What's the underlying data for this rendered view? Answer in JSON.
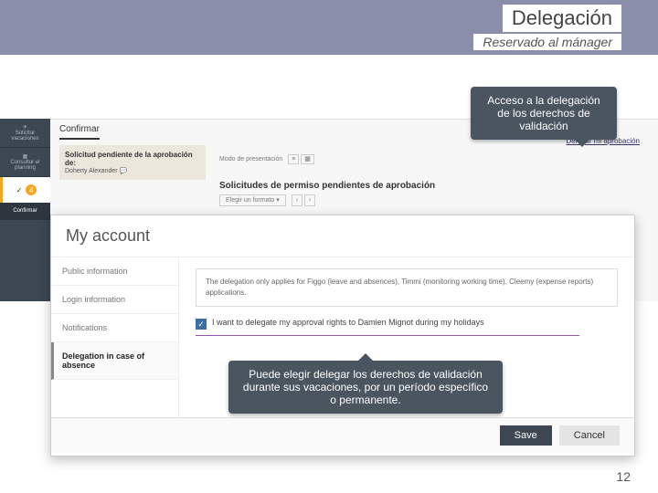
{
  "header": {
    "title": "Delegación",
    "subtitle": "Reservado al mánager"
  },
  "callouts": {
    "access": "Acceso a la delegación de los derechos de validación",
    "choose": "Puede elegir delegar los derechos de validación durante sus vacaciones, por un período específico o permanente."
  },
  "bg": {
    "sidebar": {
      "item1": "Solicitar vacaciones",
      "item2": "Consultar el planning",
      "confirm": "Confirmar",
      "badge": "4"
    },
    "tab": "Confirmar",
    "card_title": "Solicitud pendiente de la aprobación de:",
    "card_name": "Doherty Alexander",
    "mode": "Modo de presentación",
    "heading": "Solicitudes de permiso pendientes de aprobación",
    "filter": "Elegir un formato",
    "link": "Delegar mi aprobación"
  },
  "modal": {
    "title": "My account",
    "nav": {
      "pub": "Public information",
      "login": "Login information",
      "notif": "Notifications",
      "deleg": "Delegation in case of absence"
    },
    "info": "The delegation only applies for Figgo (leave and absences), Timmi (monitoring working time), Cleemy (expense reports) applications.",
    "check_text": "I want to delegate my approval rights to Damien Mignot during my holidays",
    "save": "Save",
    "cancel": "Cancel"
  },
  "page": "12"
}
